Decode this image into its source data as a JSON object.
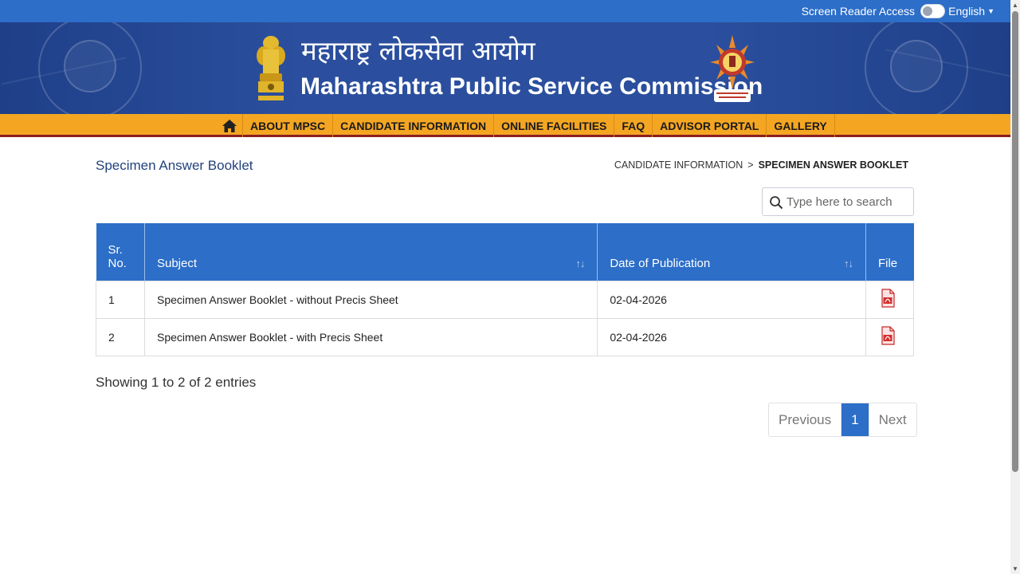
{
  "topbar": {
    "screen_reader_label": "Screen Reader Access",
    "language": "English"
  },
  "header": {
    "title_hindi": "महाराष्ट्र लोकसेवा आयोग",
    "title_english": "Maharashtra Public Service Commission"
  },
  "nav": {
    "items": [
      "ABOUT MPSC",
      "CANDIDATE INFORMATION",
      "ONLINE FACILITIES",
      "FAQ",
      "ADVISOR PORTAL",
      "GALLERY"
    ]
  },
  "content": {
    "page_title": "Specimen Answer Booklet",
    "breadcrumb_parent": "CANDIDATE INFORMATION",
    "breadcrumb_separator": ">",
    "breadcrumb_current": "SPECIMEN ANSWER BOOKLET",
    "search_placeholder": "Type here to search"
  },
  "table": {
    "headers": {
      "sr_line1": "Sr.",
      "sr_line2": "No.",
      "subject": "Subject",
      "date": "Date of Publication",
      "file": "File"
    },
    "sort_glyph": "↑↓",
    "rows": [
      {
        "sr": "1",
        "subject": "Specimen Answer Booklet - without Precis Sheet",
        "date": "02-04-2026"
      },
      {
        "sr": "2",
        "subject": "Specimen Answer Booklet - with Precis Sheet",
        "date": "02-04-2026"
      }
    ]
  },
  "footer": {
    "info": "Showing 1 to 2 of 2 entries",
    "pagination": {
      "previous": "Previous",
      "current": "1",
      "next": "Next"
    }
  },
  "colors": {
    "primary_blue": "#2c6ec8",
    "nav_orange": "#f4a623",
    "banner_blue": "#2b4f9e"
  },
  "icons": [
    "home-icon",
    "search-icon",
    "pdf-file-icon",
    "ashoka-emblem-icon",
    "mpsc-seal-icon"
  ]
}
